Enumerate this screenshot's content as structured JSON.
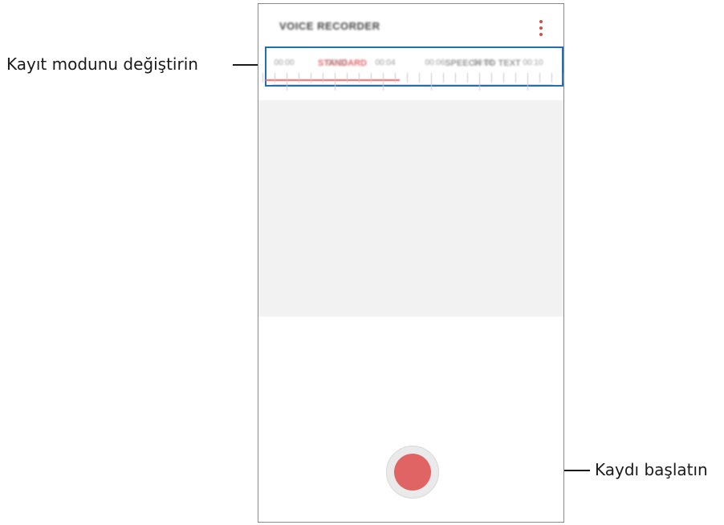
{
  "callouts": {
    "change_mode": "Kayıt modunu değiştirin",
    "start_recording": "Kaydı başlatın"
  },
  "app": {
    "title": "VOICE RECORDER",
    "menu_icon": "more-vertical-icon"
  },
  "tabs": [
    {
      "label": "STANDARD",
      "active": true
    },
    {
      "label": "SPEECH TO TEXT",
      "active": false
    }
  ],
  "timeline": {
    "labels": [
      "00:00",
      "00:02",
      "00:04",
      "00:06",
      "00:08",
      "00:10"
    ]
  },
  "record_button": {
    "icon": "record-icon",
    "color": "#e06464"
  },
  "colors": {
    "accent": "#e06a6a",
    "highlight": "#1f6fb3"
  }
}
